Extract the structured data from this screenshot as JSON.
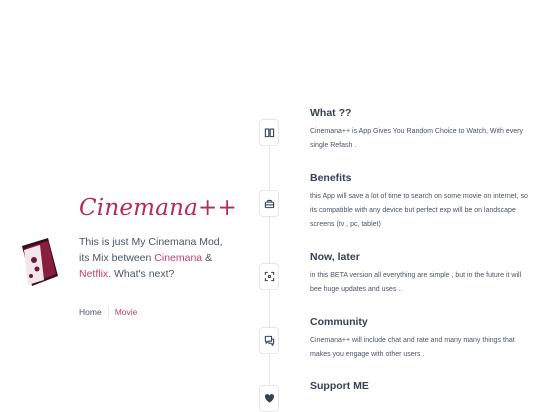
{
  "brand": {
    "title": "Cinemana++",
    "tagline_prefix": "This is just My Cinemana Mod, its Mix between ",
    "tagline_link1": "Cinemana",
    "tagline_amp": " & ",
    "tagline_link2": "Netflix",
    "tagline_suffix": ". What's next?",
    "accent_color": "#c53f6f"
  },
  "nav": {
    "home": "Home",
    "movie": "Movie"
  },
  "timeline": [
    {
      "icon": "book-icon",
      "title": "What ??",
      "desc": "Cinemana++ is App Gives You Random Choice to Watch, With every single Refash ."
    },
    {
      "icon": "briefcase-icon",
      "title": "Benefits",
      "desc": "this App will save a lot of time to search on some movie on internet, so its compatible with any device but perfect exp will be on landscape screens (tv , pc, tablet)"
    },
    {
      "icon": "focus-icon",
      "title": "Now, later",
      "desc": "in this BETA version all everything are simple , but in the future it will bee huge updates and uses .."
    },
    {
      "icon": "chat-icon",
      "title": "Community",
      "desc": "Cinemana++ will include chat and rate and many many things that makes you engage with other users ."
    },
    {
      "icon": "heart-icon",
      "title": "Support ME",
      "desc": ""
    }
  ]
}
